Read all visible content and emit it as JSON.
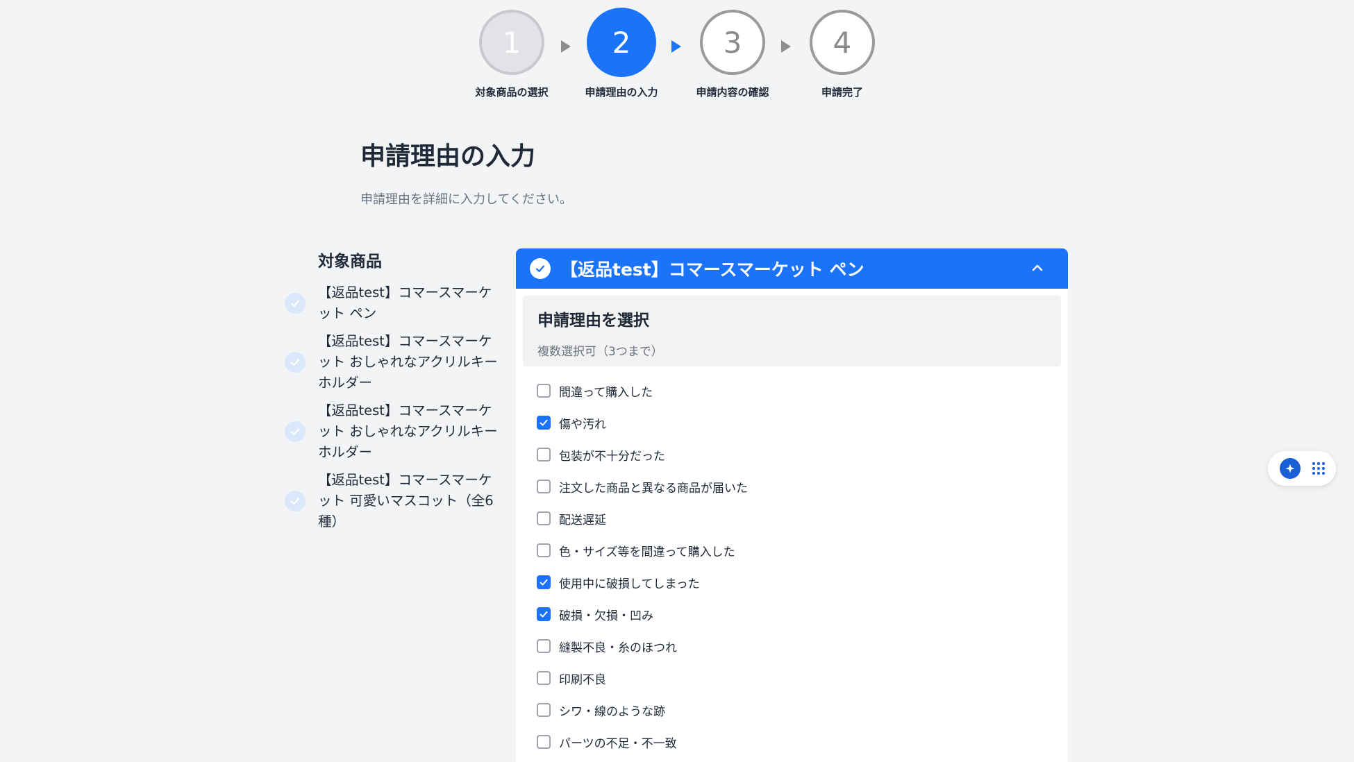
{
  "stepper": {
    "steps": [
      {
        "number": "1",
        "label": "対象商品の選択",
        "state": "done"
      },
      {
        "number": "2",
        "label": "申請理由の入力",
        "state": "active"
      },
      {
        "number": "3",
        "label": "申請内容の確認",
        "state": "todo"
      },
      {
        "number": "4",
        "label": "申請完了",
        "state": "todo"
      }
    ]
  },
  "page": {
    "title": "申請理由の入力",
    "description": "申請理由を詳細に入力してください。"
  },
  "sidebar": {
    "title": "対象商品",
    "items": [
      {
        "label": "【返品test】コマースマーケット ペン"
      },
      {
        "label": "【返品test】コマースマーケット おしゃれなアクリルキーホルダー"
      },
      {
        "label": "【返品test】コマースマーケット おしゃれなアクリルキーホルダー"
      },
      {
        "label": "【返品test】コマースマーケット 可愛いマスコット（全6種）"
      }
    ]
  },
  "panel": {
    "product_title": "【返品test】コマースマーケット ペン",
    "reason_title": "申請理由を選択",
    "reason_subtitle": "複数選択可（3つまで）",
    "options": [
      {
        "label": "間違って購入した",
        "checked": false
      },
      {
        "label": "傷や汚れ",
        "checked": true
      },
      {
        "label": "包装が不十分だった",
        "checked": false
      },
      {
        "label": "注文した商品と異なる商品が届いた",
        "checked": false
      },
      {
        "label": "配送遅延",
        "checked": false
      },
      {
        "label": "色・サイズ等を間違って購入した",
        "checked": false
      },
      {
        "label": "使用中に破損してしまった",
        "checked": true
      },
      {
        "label": "破損・欠損・凹み",
        "checked": true
      },
      {
        "label": "縫製不良・糸のほつれ",
        "checked": false
      },
      {
        "label": "印刷不良",
        "checked": false
      },
      {
        "label": "シワ・線のような跡",
        "checked": false
      },
      {
        "label": "パーツの不足・不一致",
        "checked": false
      }
    ]
  },
  "colors": {
    "accent": "#1a73f8",
    "background": "#f3f4f6"
  },
  "icons": {
    "arrow": "triangle-right-icon",
    "check": "check-icon",
    "collapse": "chevron-up-icon",
    "assistant": "sparkle-icon",
    "apps": "grid-icon"
  }
}
